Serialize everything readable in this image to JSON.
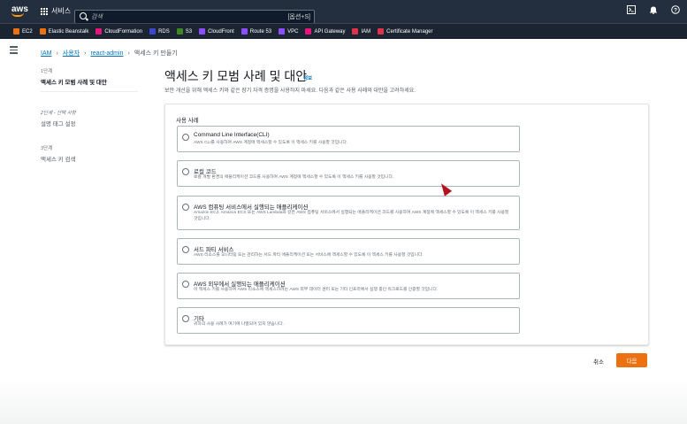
{
  "topbar": {
    "services_label": "서비스",
    "search_placeholder": "검색",
    "search_shortcut": "[옵션+S]"
  },
  "favorites": [
    {
      "label": "EC2",
      "color": "#ec7211"
    },
    {
      "label": "Elastic Beanstalk",
      "color": "#ec7211"
    },
    {
      "label": "CloudFormation",
      "color": "#e7157b"
    },
    {
      "label": "RDS",
      "color": "#3b48cc"
    },
    {
      "label": "S3",
      "color": "#3f8624"
    },
    {
      "label": "CloudFront",
      "color": "#8c4fff"
    },
    {
      "label": "Route 53",
      "color": "#8c4fff"
    },
    {
      "label": "VPC",
      "color": "#8c4fff"
    },
    {
      "label": "API Gateway",
      "color": "#e7157b"
    },
    {
      "label": "IAM",
      "color": "#dd344c"
    },
    {
      "label": "Certificate Manager",
      "color": "#dd344c"
    }
  ],
  "breadcrumb": {
    "items": [
      "IAM",
      "사용자",
      "react-admin"
    ],
    "current": "액세스 키 만들기"
  },
  "steps": [
    {
      "num": "1단계",
      "label": "액세스 키 모범 사례 및 대안"
    },
    {
      "num": "2단계 - 선택 사항",
      "label": "설명 태그 설정"
    },
    {
      "num": "3단계",
      "label": "액세스 키 검색"
    }
  ],
  "page": {
    "title": "액세스 키 모범 사례 및 대안",
    "info": "정보",
    "subtitle": "보안 개선을 위해 액세스 키와 같은 장기 자격 증명을 사용하지 마세요. 다음과 같은 사용 사례와 대안을 고려하세요.",
    "panel_label": "사용 사례"
  },
  "options": [
    {
      "title": "Command Line Interface(CLI)",
      "desc": "AWS CLI를 사용하여 AWS 계정에 액세스할 수 있도록 이 액세스 키를 사용할 것입니다."
    },
    {
      "title": "로컬 코드",
      "desc": "로컬 개발 환경의 애플리케이션 코드를 사용하여 AWS 계정에 액세스할 수 있도록 이 액세스 키를 사용할 것입니다."
    },
    {
      "title": "AWS 컴퓨팅 서비스에서 실행되는 애플리케이션",
      "desc": "Amazon EC2, Amazon ECS 또는 AWS Lambda와 같은 AWS 컴퓨팅 서비스에서 실행되는 애플리케이션 코드를 사용하여 AWS 계정에 액세스할 수 있도록 이 액세스 키를 사용할 것입니다."
    },
    {
      "title": "서드 파티 서비스",
      "desc": "AWS 리소스를 모니터링 또는 관리하는 서드 파티 애플리케이션 또는 서비스에 액세스할 수 있도록 이 액세스 키를 사용할 것입니다."
    },
    {
      "title": "AWS 외부에서 실행되는 애플리케이션",
      "desc": "이 액세스 키를 사용하여 AWS 리소스에 액세스하려는 AWS 외부 데이터 센터 또는 기타 인프라에서 실행 중인 워크로드를 인증할 것입니다."
    },
    {
      "title": "기타",
      "desc": "귀하의 사용 사례가 여기에 나열되어 있지 않습니다."
    }
  ],
  "footer": {
    "cancel": "취소",
    "next": "다음"
  }
}
